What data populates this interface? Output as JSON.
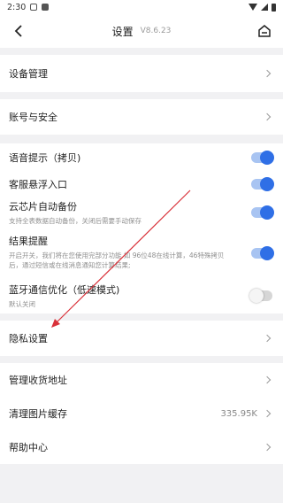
{
  "status_bar": {
    "time": "2:30"
  },
  "header": {
    "title": "设置",
    "version": "V8.6.23"
  },
  "groups": {
    "device": {
      "label": "设备管理"
    },
    "account": {
      "label": "账号与安全"
    },
    "voice": {
      "label": "语音提示（拷贝)",
      "on": true
    },
    "float": {
      "label": "客服悬浮入口",
      "on": true
    },
    "cloud": {
      "label": "云芯片自动备份",
      "sub": "支持全表数据自动备份，关闭后需要手动保存",
      "on": true
    },
    "result": {
      "label": "结果提醒",
      "sub": "开启开关，我们将在您使用完部分功能 如 96位48在线计算，46特殊拷贝后，通过短信或在线消息通知您计算结果;",
      "on": true
    },
    "bluetooth": {
      "label": "蓝牙通信优化（低速模式)",
      "sub": "默认关闭",
      "on": false
    },
    "privacy": {
      "label": "隐私设置"
    },
    "address": {
      "label": "管理收货地址"
    },
    "cache": {
      "label": "清理图片缓存",
      "value": "335.95K"
    },
    "help": {
      "label": "帮助中心"
    }
  },
  "colors": {
    "accent": "#2f6fe6",
    "annotation_arrow": "#d9323a"
  }
}
